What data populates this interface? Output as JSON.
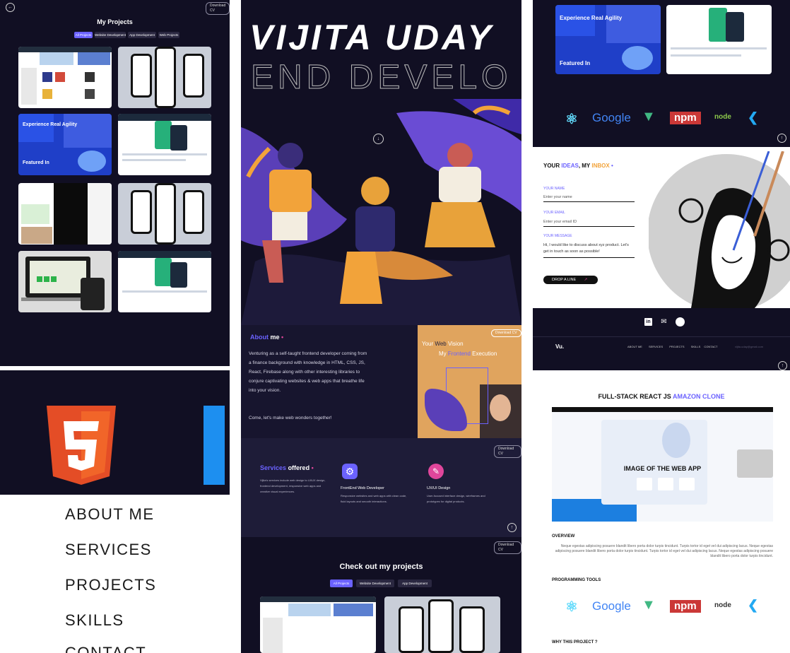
{
  "projects_panel": {
    "title": "My Projects",
    "download_cv": "Download CV",
    "filters": [
      "All Projects",
      "Website Development",
      "App Development",
      "Web Projects"
    ]
  },
  "hero": {
    "name": "VIJITA UDAY",
    "role": "END DEVELO"
  },
  "about": {
    "heading_a": "About",
    "heading_b": "me",
    "body": "Venturing as a self-taught frontend developer coming from a finance background with knowledge in HTML, CSS, JS, React, Firebase along with other interesting libraries to conjure captivating websites & web apps that breathe life into your vision.",
    "closing": "Come, let's make web wonders together!",
    "download_cv": "Download CV",
    "vision_your": "Your",
    "vision_web": "Web",
    "vision_word": "Vision",
    "vision_my": "My",
    "vision_frontend": "Frontend",
    "vision_execution": "Execution"
  },
  "services": {
    "heading_a": "Services",
    "heading_b": "offered",
    "download_cv": "Download CV",
    "intro": "Vijita's services include web design to UI/UX design, frontend development, responsive web apps and creative visual experiences.",
    "items": [
      {
        "title": "FrontEnd Web Developer",
        "desc": "Responsive websites and web apps with clean code, fluid layouts and smooth interactions."
      },
      {
        "title": "UX/UI Design",
        "desc": "User-focused interface design, wireframes and prototypes for digital products."
      }
    ]
  },
  "check_projects": {
    "title": "Check out my projects",
    "download_cv": "Download CV",
    "filters": [
      "All Projects",
      "Website Development",
      "App Development"
    ]
  },
  "skills_strip": {
    "logos": [
      "Google",
      "npm",
      "node"
    ]
  },
  "contact": {
    "heading_your": "YOUR",
    "heading_ideas": "IDEAS",
    "heading_my": ", MY",
    "heading_inbox": "INBOX",
    "name_label": "YOUR NAME",
    "name_placeholder": "Enter your name",
    "email_label": "YOUR EMAIL",
    "email_placeholder": "Enter your email ID",
    "message_label": "YOUR MESSAGE",
    "message_text": "Hi, I would like to discuss about xyz product. Let's get in touch as soon as possible!",
    "submit": "DROP A LINE"
  },
  "footer": {
    "logo": "Vu.",
    "nav": [
      "ABOUT ME",
      "SERVICES",
      "PROJECTS",
      "SKILLS",
      "CONTACT"
    ],
    "email": "vijita.uday@gmail.com"
  },
  "project_detail": {
    "title_a": "FULL-STACK REACT JS",
    "title_b": "AMAZON CLONE",
    "image_caption": "IMAGE OF THE WEB APP",
    "overview_label": "OVERVIEW",
    "overview_text": "Neque egestas adipiscing posuere blandit libero porta dolor turpis tincidunt. Turpis tortor id eget vel dui adipiscing lacus. Neque egestas adipiscing posuere blandit libero porta dolor turpis tincidunt. Turpis tortor id eget vel dui adipiscing lacus. Neque egestas adipiscing posuere blandit libero porta dolor turpis tincidunt.",
    "tools_label": "PROGRAMMING TOOLS",
    "tools": [
      "Google",
      "npm",
      "node"
    ],
    "why_label": "WHY THIS PROJECT ?"
  },
  "mobile_menu": {
    "items": [
      "ABOUT ME",
      "SERVICES",
      "PROJECTS",
      "SKILLS",
      "CONTACT"
    ]
  },
  "colors": {
    "dark_bg": "#110f23",
    "accent_purple": "#6b62ff",
    "accent_orange": "#f2a33a",
    "html5_orange": "#e44d26"
  }
}
